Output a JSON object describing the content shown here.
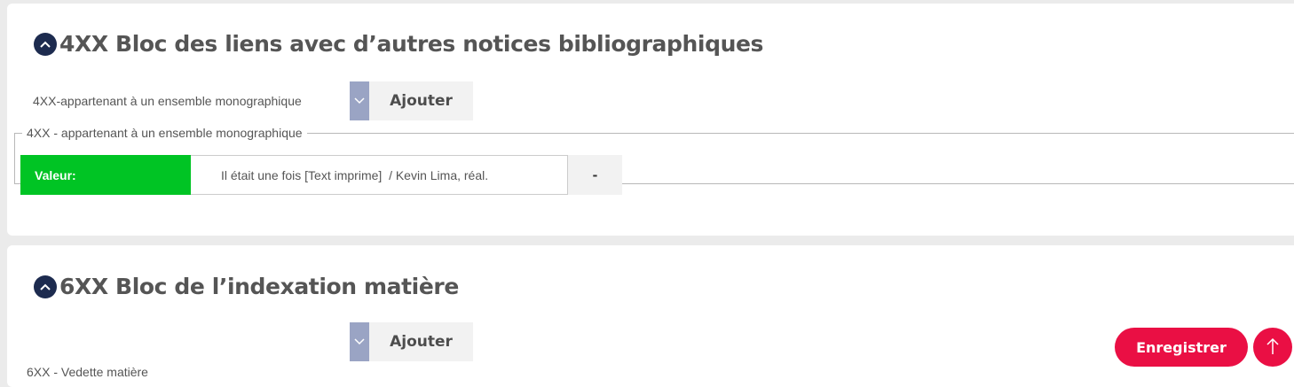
{
  "sections": [
    {
      "title": "4XX Bloc des liens avec d’autres notices bibliographiques",
      "select": {
        "selected": "4XX-appartenant à un ensemble monographique",
        "add_label": "Ajouter"
      },
      "group": {
        "legend": "4XX - appartenant à un ensemble monographique",
        "value_label": "Valeur:",
        "value": "Il était une fois [Text imprime]  / Kevin Lima, réal.",
        "remove_label": "-"
      }
    },
    {
      "title": "6XX Bloc de l’indexation matière",
      "select": {
        "add_label": "Ajouter"
      },
      "partial_label": "6XX - Vedette matière"
    }
  ],
  "actions": {
    "save_label": "Enregistrer",
    "scroll_top_icon": "arrow-up-icon",
    "accent_color": "#ea0f44"
  },
  "colors": {
    "collapse_icon": "#1d2b4f",
    "value_label_bg": "#00c424",
    "select_arrow_bg": "#9aa4c4"
  }
}
